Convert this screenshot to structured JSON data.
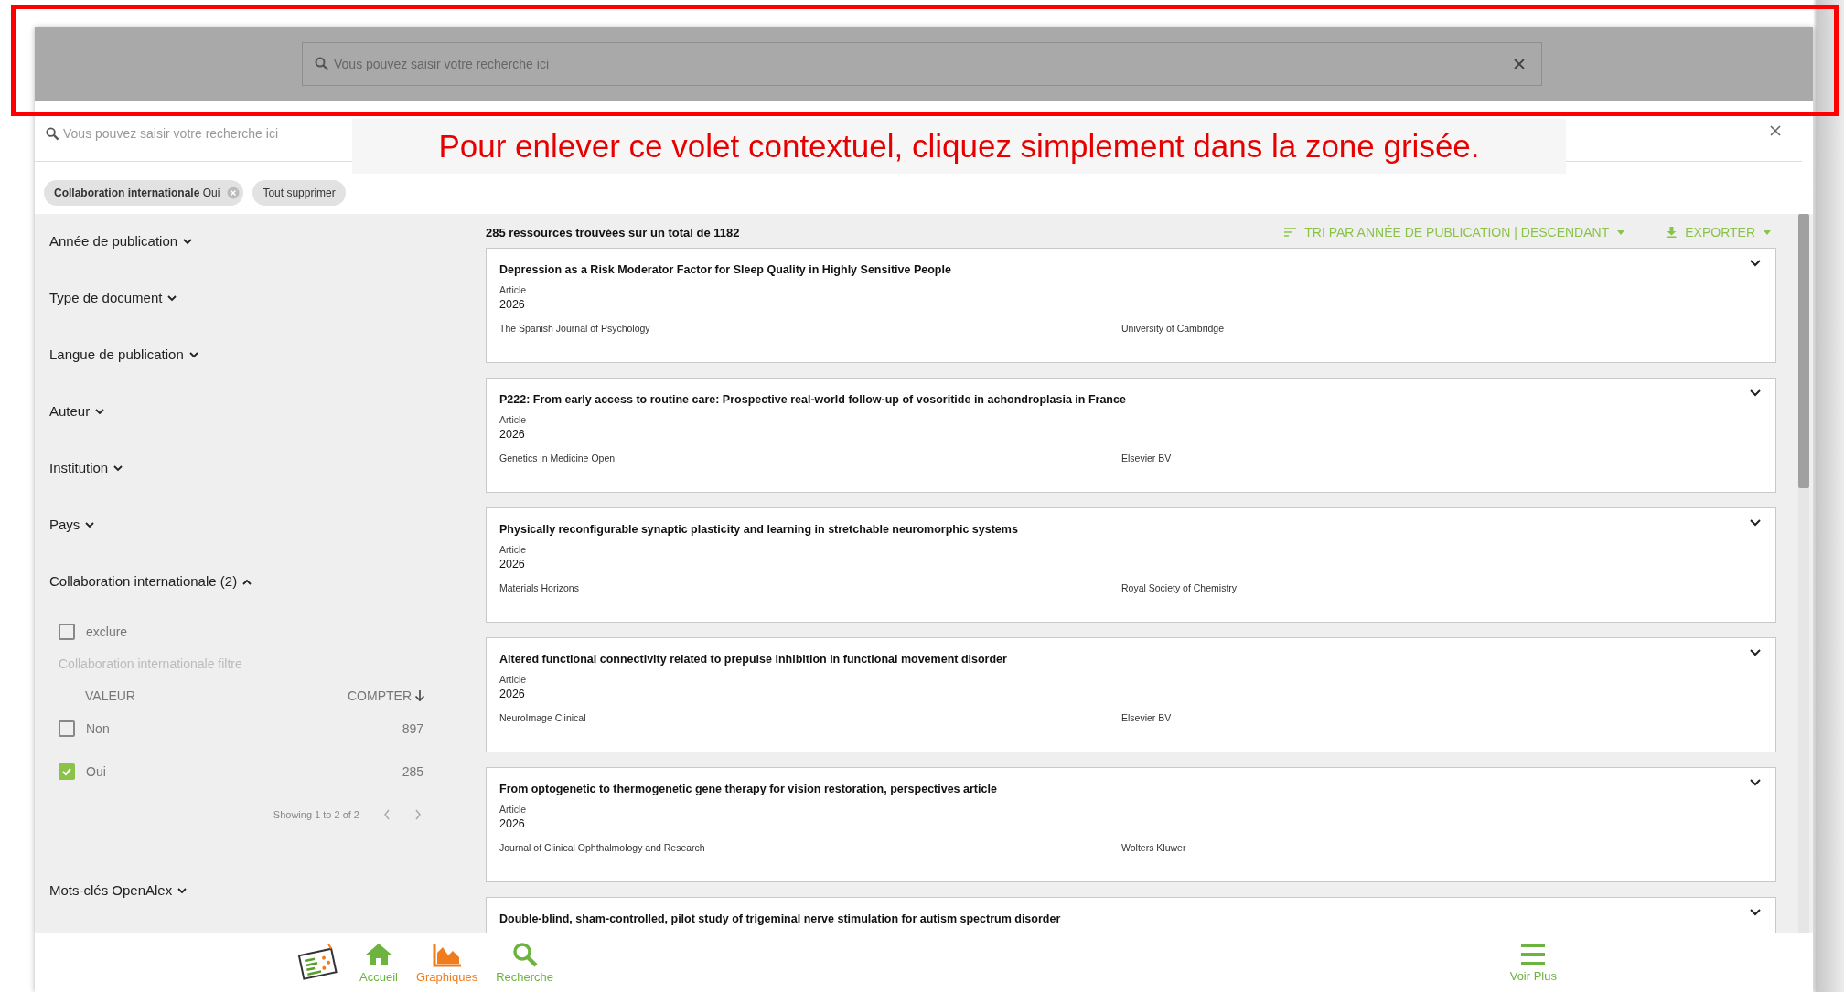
{
  "overlay_search": {
    "placeholder": "Vous pouvez saisir votre recherche ici"
  },
  "annotation": "Pour enlever ce volet contextuel, cliquez simplement dans la zone grisée.",
  "search": {
    "placeholder": "Vous pouvez saisir votre recherche ici"
  },
  "chips": [
    {
      "label": "Collaboration internationale",
      "value": "Oui"
    }
  ],
  "clear_all": "Tout supprimer",
  "facets": [
    {
      "label": "Année de publication",
      "expanded": false
    },
    {
      "label": "Type de document",
      "expanded": false
    },
    {
      "label": "Langue de publication",
      "expanded": false
    },
    {
      "label": "Auteur",
      "expanded": false
    },
    {
      "label": "Institution",
      "expanded": false
    },
    {
      "label": "Pays",
      "expanded": false
    },
    {
      "label": "Collaboration internationale (2)",
      "expanded": true,
      "panel": {
        "exclude": {
          "label": "exclure",
          "checked": false
        },
        "filter_placeholder": "Collaboration internationale filtre",
        "columns": [
          "VALEUR",
          "COMPTER"
        ],
        "rows": [
          {
            "value": "Non",
            "count": "897",
            "checked": false
          },
          {
            "value": "Oui",
            "count": "285",
            "checked": true
          }
        ],
        "pagination": "Showing 1 to 2 of 2"
      }
    },
    {
      "label": "Mots-clés OpenAlex",
      "expanded": false
    }
  ],
  "results": {
    "summary": "285 ressources trouvées sur un total de 1182",
    "sort": "TRI PAR ANNÉE DE PUBLICATION | DESCENDANT",
    "export": "EXPORTER",
    "items": [
      {
        "title": "Depression as a Risk Moderator Factor for Sleep Quality in Highly Sensitive People",
        "type": "Article",
        "year": "2026",
        "source": "The Spanish Journal of Psychology",
        "publisher": "University of Cambridge"
      },
      {
        "title": "P222: From early access to routine care: Prospective real-world follow-up of vosoritide in achondroplasia in France",
        "type": "Article",
        "year": "2026",
        "source": "Genetics in Medicine Open",
        "publisher": "Elsevier BV"
      },
      {
        "title": "Physically reconfigurable synaptic plasticity and learning in stretchable neuromorphic systems",
        "type": "Article",
        "year": "2026",
        "source": "Materials Horizons",
        "publisher": "Royal Society of Chemistry"
      },
      {
        "title": "Altered functional connectivity related to prepulse inhibition in functional movement disorder",
        "type": "Article",
        "year": "2026",
        "source": "NeuroImage Clinical",
        "publisher": "Elsevier BV"
      },
      {
        "title": "From optogenetic to thermogenetic gene therapy for vision restoration, perspectives article",
        "type": "Article",
        "year": "2026",
        "source": "Journal of Clinical Ophthalmology and Research",
        "publisher": "Wolters Kluwer"
      },
      {
        "title": "Double-blind, sham-controlled, pilot study of trigeminal nerve stimulation for autism spectrum disorder"
      }
    ]
  },
  "bottom_nav": [
    {
      "kind": "home",
      "label": "Accueil",
      "selected": false
    },
    {
      "kind": "charts",
      "label": "Graphiques",
      "selected": true
    },
    {
      "kind": "search",
      "label": "Recherche",
      "selected": false
    }
  ],
  "more": {
    "label": "Voir Plus"
  }
}
